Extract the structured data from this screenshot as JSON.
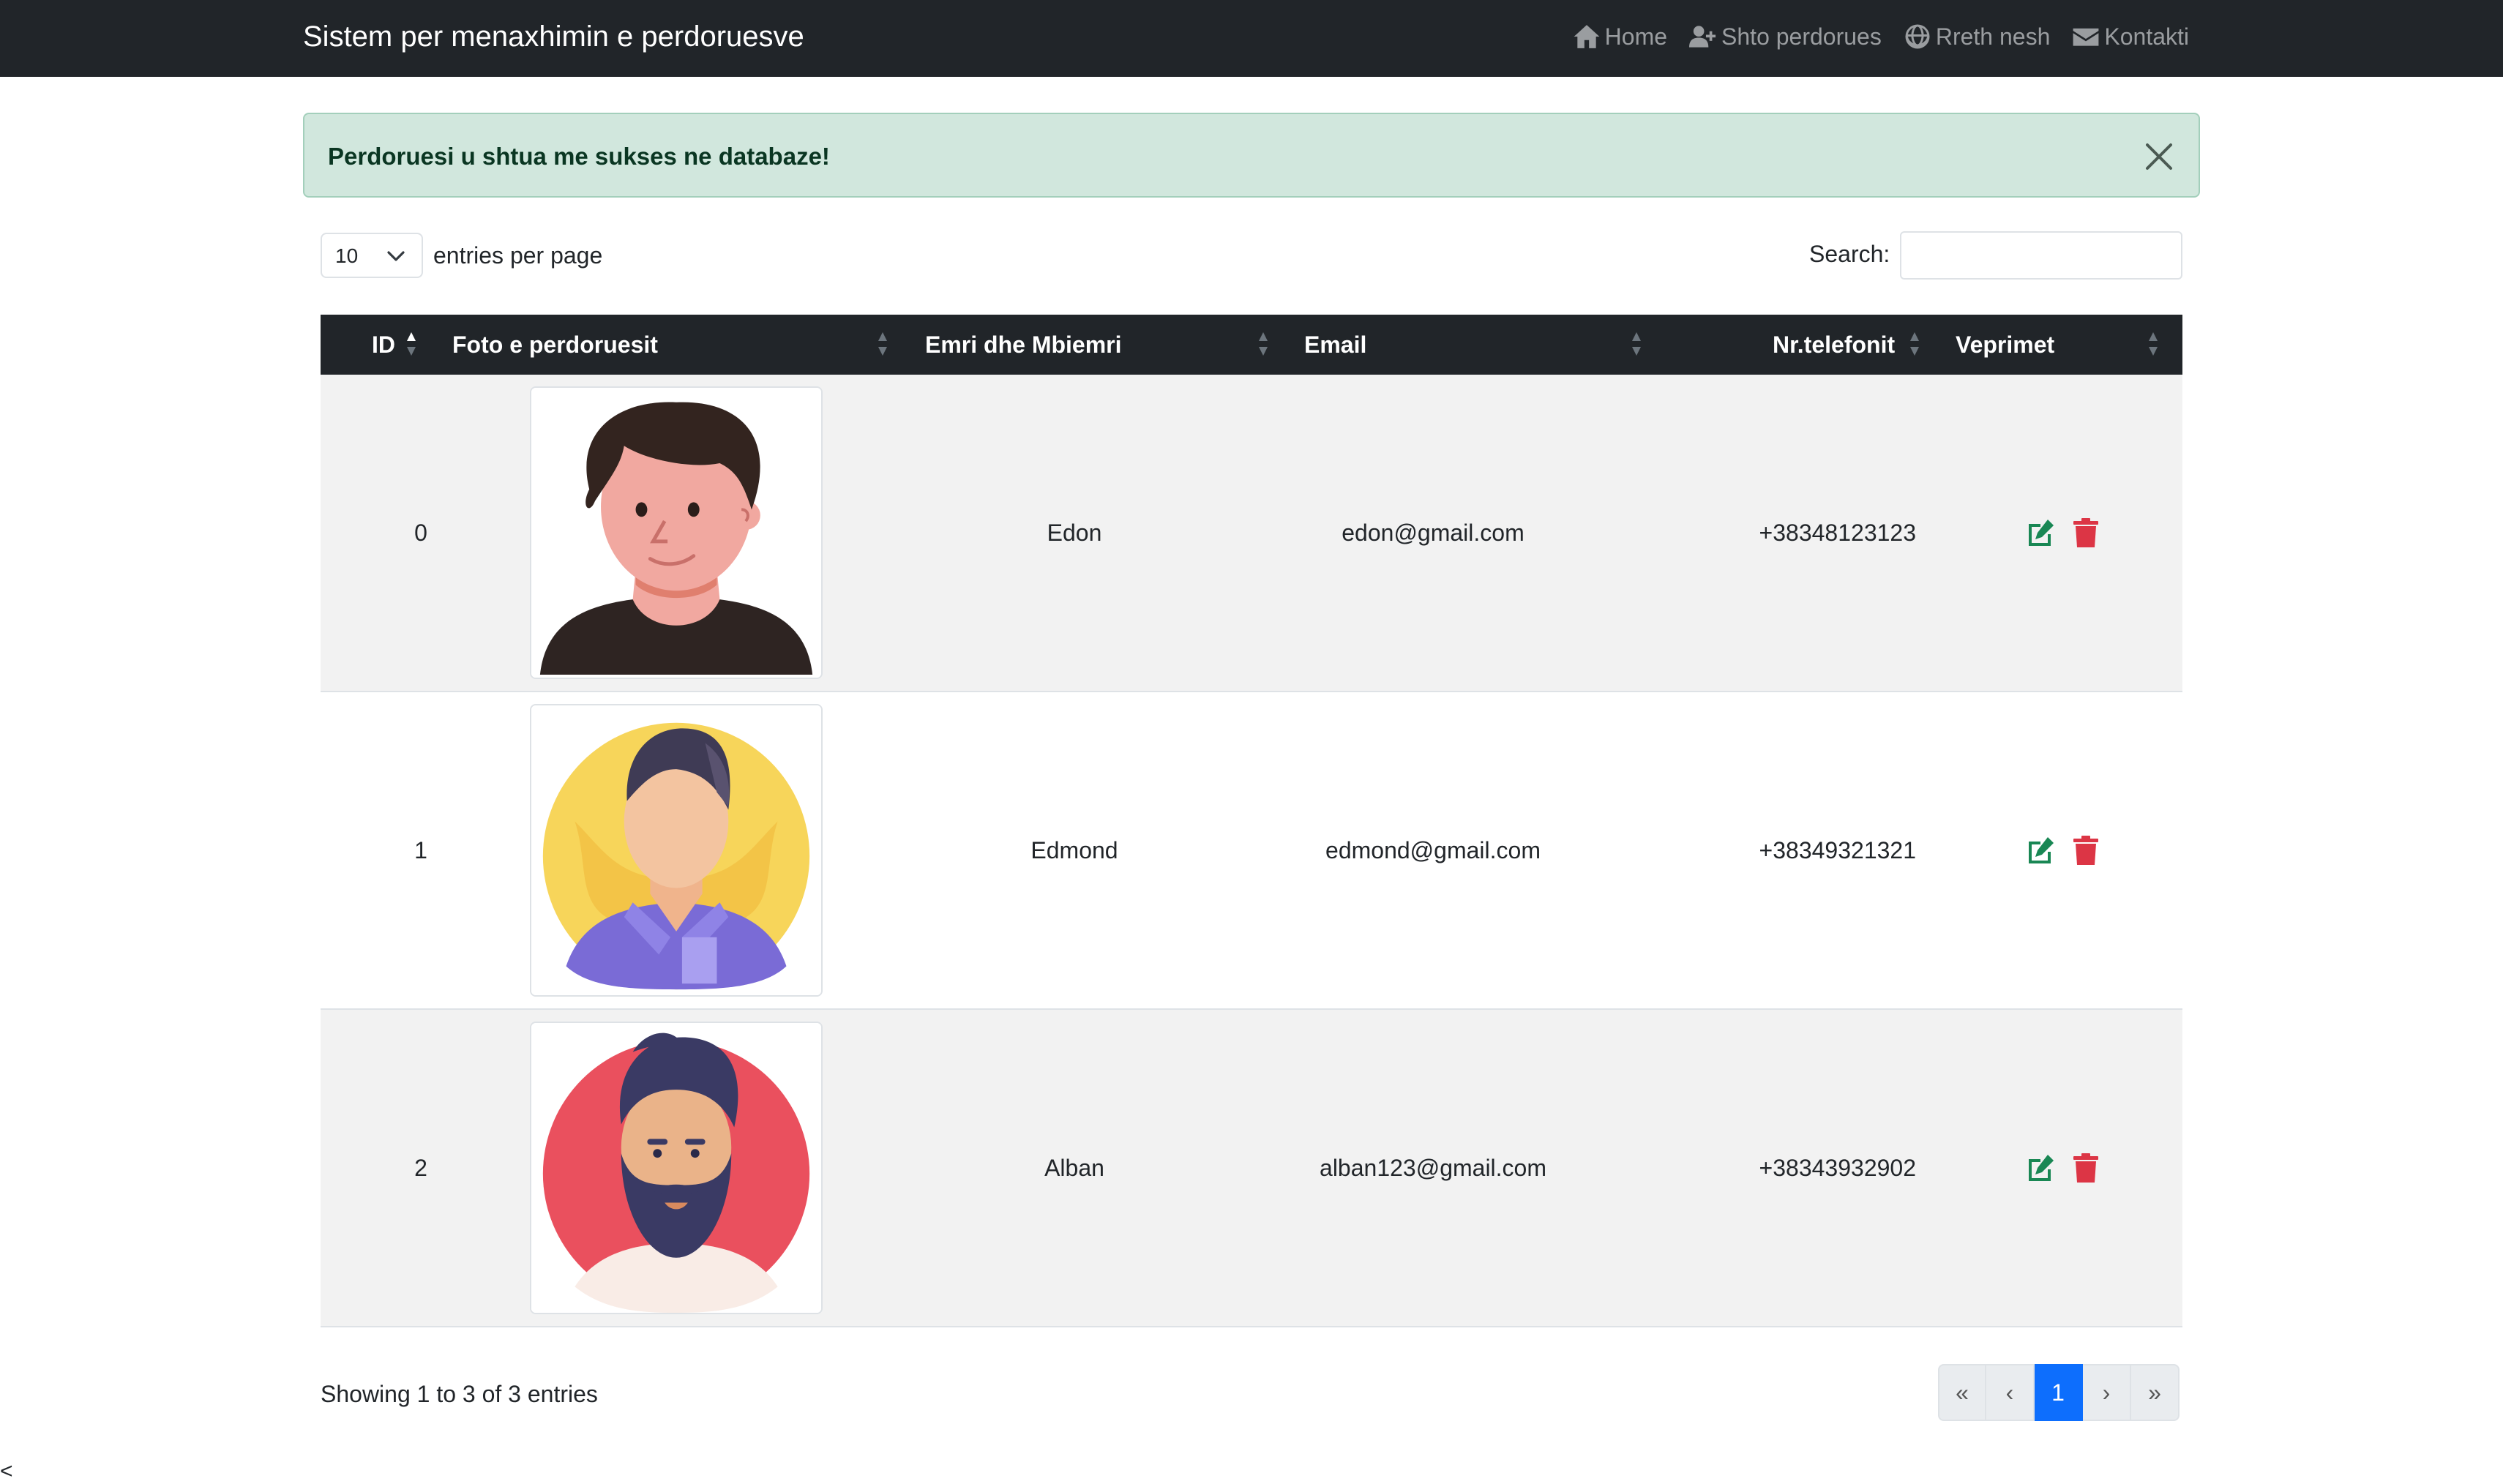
{
  "navbar": {
    "brand": "Sistem per menaxhimin e perdoruesve",
    "links": [
      {
        "label": "Home",
        "icon": "home-icon"
      },
      {
        "label": "Shto perdorues",
        "icon": "user-plus-icon"
      },
      {
        "label": "Rreth nesh",
        "icon": "globe-icon"
      },
      {
        "label": "Kontakti",
        "icon": "envelope-icon"
      }
    ]
  },
  "alert": {
    "message": "Perdoruesi u shtua me sukses ne databaze!",
    "close_icon": "close-icon"
  },
  "controls": {
    "entries_value": "10",
    "entries_label": "entries per page",
    "search_label": "Search:",
    "search_value": ""
  },
  "table": {
    "columns": [
      "ID",
      "Foto e perdoruesit",
      "Emri dhe Mbiemri",
      "Email",
      "Nr.telefonit",
      "Veprimet"
    ],
    "rows": [
      {
        "id": "0",
        "name": "Edon",
        "email": "edon@gmail.com",
        "phone": "+38348123123",
        "avatar": "avatar-young-man"
      },
      {
        "id": "1",
        "name": "Edmond",
        "email": "edmond@gmail.com",
        "phone": "+38349321321",
        "avatar": "avatar-man-yellow-bg"
      },
      {
        "id": "2",
        "name": "Alban",
        "email": "alban123@gmail.com",
        "phone": "+38343932902",
        "avatar": "avatar-bearded-man-red-bg"
      }
    ],
    "action_icons": [
      "edit-icon",
      "trash-icon"
    ],
    "colors": {
      "edit": "#198754",
      "delete": "#dc3545",
      "header": "#212529"
    }
  },
  "footer": {
    "info": "Showing 1 to 3 of 3 entries",
    "pages": [
      "«",
      "‹",
      "1",
      "›",
      "»"
    ],
    "active_page": "1"
  },
  "stray_text": "<",
  "colors": {
    "navbar": "#212529",
    "alert_bg": "#d1e7dd",
    "primary": "#0d6efd"
  }
}
